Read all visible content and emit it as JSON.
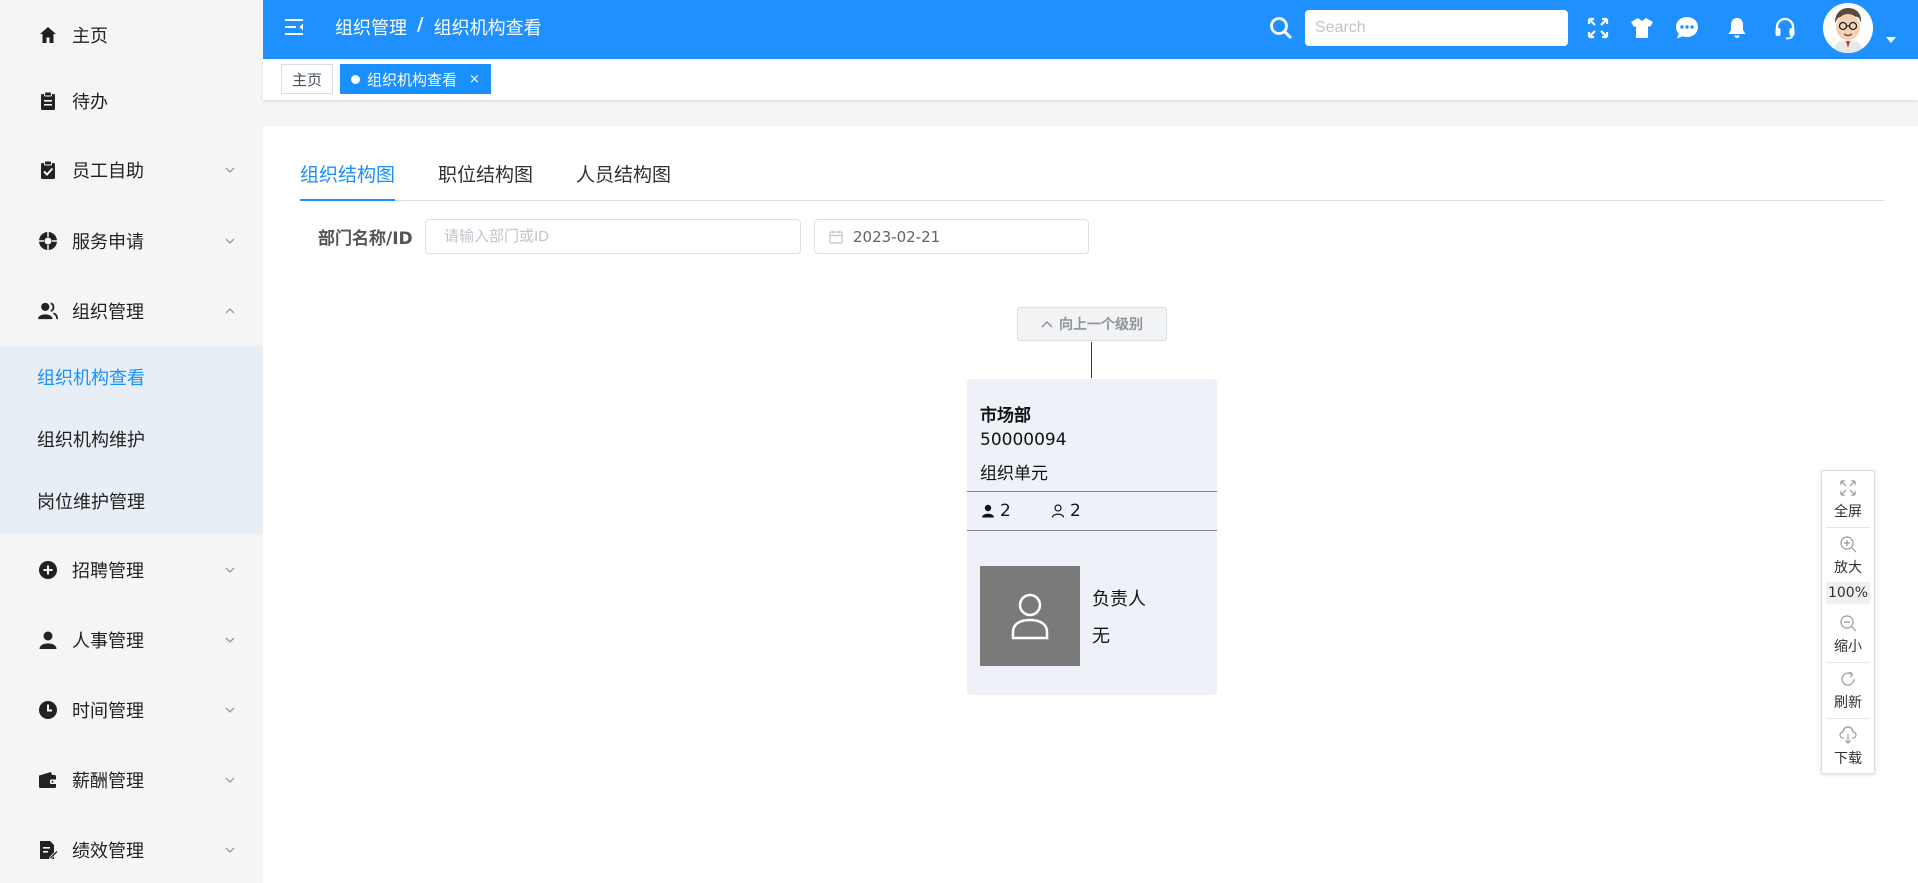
{
  "sidebar": {
    "items": [
      {
        "label": "主页",
        "icon": "home-icon"
      },
      {
        "label": "待办",
        "icon": "clipboard-icon"
      },
      {
        "label": "员工自助",
        "icon": "clipboard-check-icon"
      },
      {
        "label": "服务申请",
        "icon": "lifebuoy-icon"
      },
      {
        "label": "组织管理",
        "icon": "users-icon"
      },
      {
        "label": "招聘管理",
        "icon": "plus-circle-icon"
      },
      {
        "label": "人事管理",
        "icon": "user-icon"
      },
      {
        "label": "时间管理",
        "icon": "clock-icon"
      },
      {
        "label": "薪酬管理",
        "icon": "wallet-icon"
      },
      {
        "label": "绩效管理",
        "icon": "document-edit-icon"
      }
    ],
    "submenu": [
      "组织机构查看",
      "组织机构维护",
      "岗位维护管理"
    ]
  },
  "header": {
    "breadcrumb": [
      "组织管理",
      "/",
      "组织机构查看"
    ],
    "search_placeholder": "Search",
    "icons": [
      "fullscreen-icon",
      "shirt-icon",
      "chat-icon",
      "bell-icon",
      "headset-icon"
    ]
  },
  "tags": {
    "home": "主页",
    "active": "组织机构查看",
    "close": "×"
  },
  "main": {
    "tabs": [
      "组织结构图",
      "职位结构图",
      "人员结构图"
    ],
    "filter": {
      "label": "部门名称/ID",
      "placeholder": "请输入部门或ID",
      "date": "2023-02-21"
    },
    "up_button": "向上一个级别",
    "org": {
      "name": "市场部",
      "id": "50000094",
      "type": "组织单元",
      "stat1": "2",
      "stat2": "2",
      "leader_label": "负责人",
      "leader_value": "无"
    }
  },
  "toolbar": {
    "fullscreen": "全屏",
    "zoom_in": "放大",
    "zoom_level": "100%",
    "zoom_out": "缩小",
    "refresh": "刷新",
    "download": "下载"
  },
  "colors": {
    "primary": "#1890ff",
    "header_bg": "#1e90ff",
    "submenu_bg": "#e8eef6",
    "card_bg": "#eef2f8"
  }
}
